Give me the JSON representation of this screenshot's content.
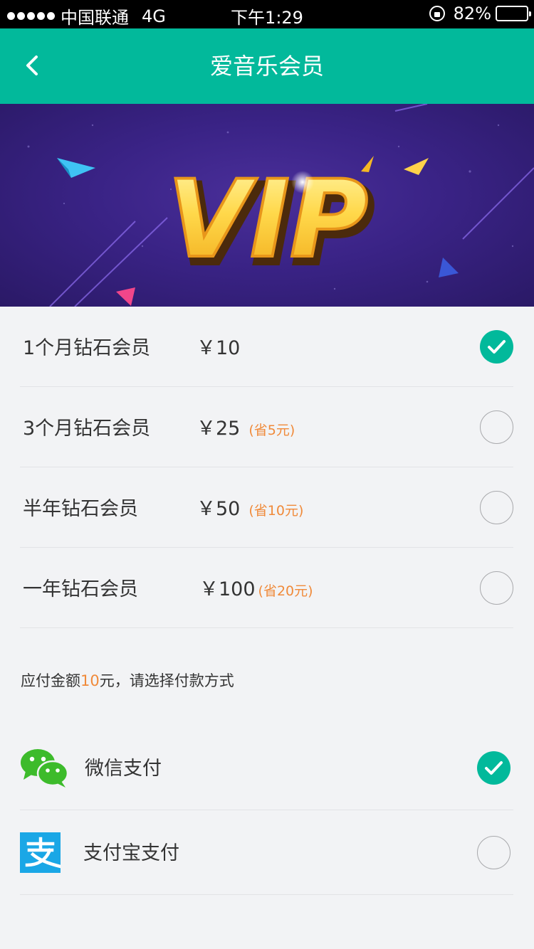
{
  "status_bar": {
    "carrier": "中国联通",
    "network": "4G",
    "time": "下午1:29",
    "battery": "82%",
    "battery_level": 0.82
  },
  "nav": {
    "title": "爱音乐会员",
    "back_icon": "chevron-left-icon"
  },
  "banner": {
    "text": "VIP"
  },
  "plans": [
    {
      "name": "1个月钻石会员",
      "price": "￥10",
      "save": "",
      "selected": true
    },
    {
      "name": "3个月钻石会员",
      "price": "￥25",
      "save": "(省5元)",
      "selected": false
    },
    {
      "name": "半年钻石会员",
      "price": "￥50",
      "save": "(省10元)",
      "selected": false
    },
    {
      "name": "一年钻石会员",
      "price": "￥100",
      "save": "(省20元)",
      "selected": false
    }
  ],
  "payment_prompt": {
    "prefix": "应付金额",
    "amount": "10",
    "suffix": "元，请选择付款方式"
  },
  "payments": [
    {
      "label": "微信支付",
      "icon": "wechat-pay-icon",
      "selected": true
    },
    {
      "label": "支付宝支付",
      "icon": "alipay-icon",
      "selected": false
    }
  ],
  "colors": {
    "accent": "#02b99b",
    "highlight": "#f08a3a",
    "background": "#f2f3f5",
    "banner": "#3a2386"
  }
}
